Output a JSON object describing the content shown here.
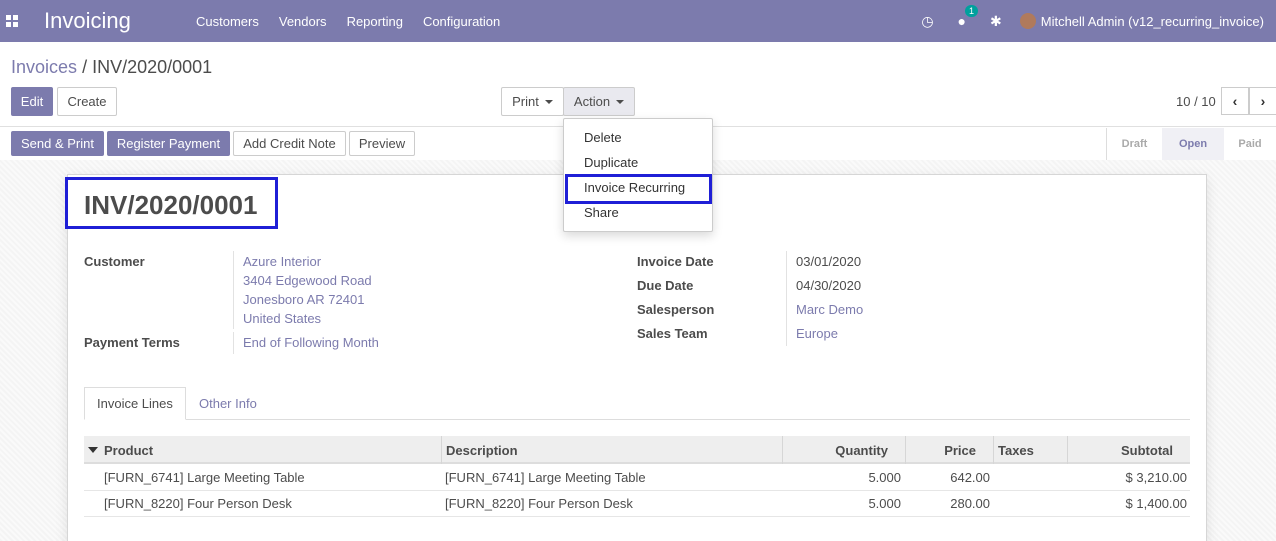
{
  "navbar": {
    "app_title": "Invoicing",
    "menu": [
      "Customers",
      "Vendors",
      "Reporting",
      "Configuration"
    ],
    "messages_count": "1",
    "user": "Mitchell Admin (v12_recurring_invoice)",
    "clock_glyph": "◷",
    "chat_glyph": "●",
    "bug_glyph": "✱"
  },
  "breadcrumb": {
    "parent": "Invoices",
    "separator": "/",
    "current": "INV/2020/0001"
  },
  "buttons": {
    "edit": "Edit",
    "create": "Create",
    "print": "Print",
    "action": "Action",
    "send_print": "Send & Print",
    "register_payment": "Register Payment",
    "add_credit_note": "Add Credit Note",
    "preview": "Preview"
  },
  "pager": {
    "value": "10 / 10",
    "prev": "‹",
    "next": "›"
  },
  "statusbar": {
    "stages": [
      "Draft",
      "Open",
      "Paid"
    ],
    "active": "Open"
  },
  "action_menu": [
    "Delete",
    "Duplicate",
    "Invoice Recurring",
    "Share"
  ],
  "invoice": {
    "number": "INV/2020/0001",
    "customer_label": "Customer",
    "customer_lines": [
      "Azure Interior",
      "3404 Edgewood Road",
      "Jonesboro AR 72401",
      "United States"
    ],
    "payment_terms_label": "Payment Terms",
    "payment_terms": "End of Following Month",
    "invoice_date_label": "Invoice Date",
    "invoice_date": "03/01/2020",
    "due_date_label": "Due Date",
    "due_date": "04/30/2020",
    "salesperson_label": "Salesperson",
    "salesperson": "Marc Demo",
    "sales_team_label": "Sales Team",
    "sales_team": "Europe"
  },
  "tabs": [
    "Invoice Lines",
    "Other Info"
  ],
  "table": {
    "headers": [
      "Product",
      "Description",
      "Quantity",
      "Price",
      "Taxes",
      "Subtotal"
    ],
    "rows": [
      [
        "[FURN_6741] Large Meeting Table",
        "[FURN_6741] Large Meeting Table",
        "5.000",
        "642.00",
        "",
        "$ 3,210.00"
      ],
      [
        "[FURN_8220] Four Person Desk",
        "[FURN_8220] Four Person Desk",
        "5.000",
        "280.00",
        "",
        "$ 1,400.00"
      ]
    ]
  },
  "colors": {
    "brand": "#7c7bad",
    "highlight": "#1f1fd6"
  }
}
